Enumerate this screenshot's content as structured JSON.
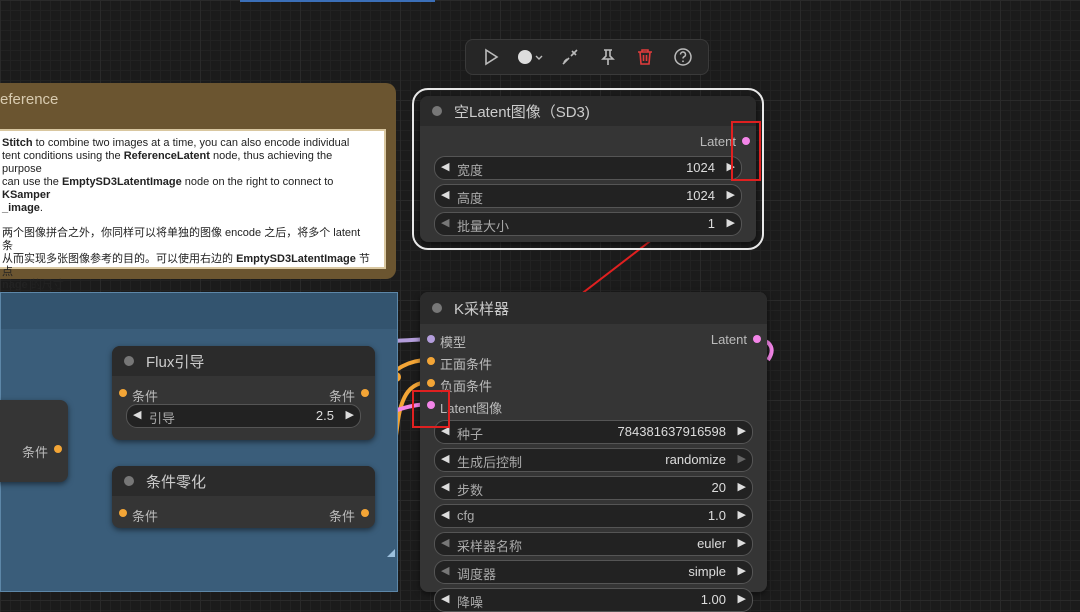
{
  "toolbar": {
    "buttons": [
      {
        "icon": "play-icon"
      },
      {
        "icon": "color-circle-icon"
      },
      {
        "icon": "bypass-icon"
      },
      {
        "icon": "pin-icon"
      },
      {
        "icon": "trash-icon"
      },
      {
        "icon": "help-icon"
      }
    ]
  },
  "note": {
    "title": "eference",
    "en_lines": [
      {
        "b1": "Stitch",
        "t1": " to combine two images at a time, you can also encode individual"
      },
      {
        "t1": "tent conditions using the ",
        "b1": "ReferenceLatent",
        "t2": " node, thus achieving the purpose"
      },
      {
        "t1": "can use the ",
        "b1": "EmptySD3LatentImage",
        "t2": " node on the right to connect to ",
        "b2": "KSamper"
      },
      {
        "b1": "_image",
        "t1": "."
      }
    ],
    "zh_lines": [
      {
        "t1": "两个图像拼合之外，你同样可以将单独的图像 encode 之后，将多个 latent 条"
      },
      {
        "t1": " 从而实现多张图像参考的目的。可以使用右边的 ",
        "b1": "EmptySD3LatentImage",
        "t2": " 节点"
      },
      {
        "b1": "nage",
        "t1": " 的尺寸"
      }
    ]
  },
  "latent_node": {
    "title": "空Latent图像（SD3)",
    "output": "Latent",
    "widgets": [
      {
        "label": "宽度",
        "value": "1024"
      },
      {
        "label": "高度",
        "value": "1024"
      },
      {
        "label": "批量大小",
        "value": "1"
      }
    ]
  },
  "ksampler": {
    "title": "K采样器",
    "inputs": [
      {
        "label": "模型",
        "color": "#b39ddb"
      },
      {
        "label": "正面条件",
        "color": "#f3a536"
      },
      {
        "label": "负面条件",
        "color": "#f3a536"
      },
      {
        "label": "Latent图像",
        "color": "#f385e8"
      }
    ],
    "output": "Latent",
    "widgets": [
      {
        "label": "种子",
        "value": "784381637916598"
      },
      {
        "label": "生成后控制",
        "value": "randomize"
      },
      {
        "label": "步数",
        "value": "20"
      },
      {
        "label": "cfg",
        "value": "1.0"
      },
      {
        "label": "采样器名称",
        "value": "euler"
      },
      {
        "label": "调度器",
        "value": "simple"
      },
      {
        "label": "降噪",
        "value": "1.00"
      }
    ]
  },
  "flux_node": {
    "title": "Flux引导",
    "input": "条件",
    "output": "条件",
    "widget": {
      "label": "引导",
      "value": "2.5"
    }
  },
  "zero_node": {
    "title": "条件零化",
    "input": "条件",
    "output": "条件"
  },
  "left_node": {
    "output": "条件"
  }
}
